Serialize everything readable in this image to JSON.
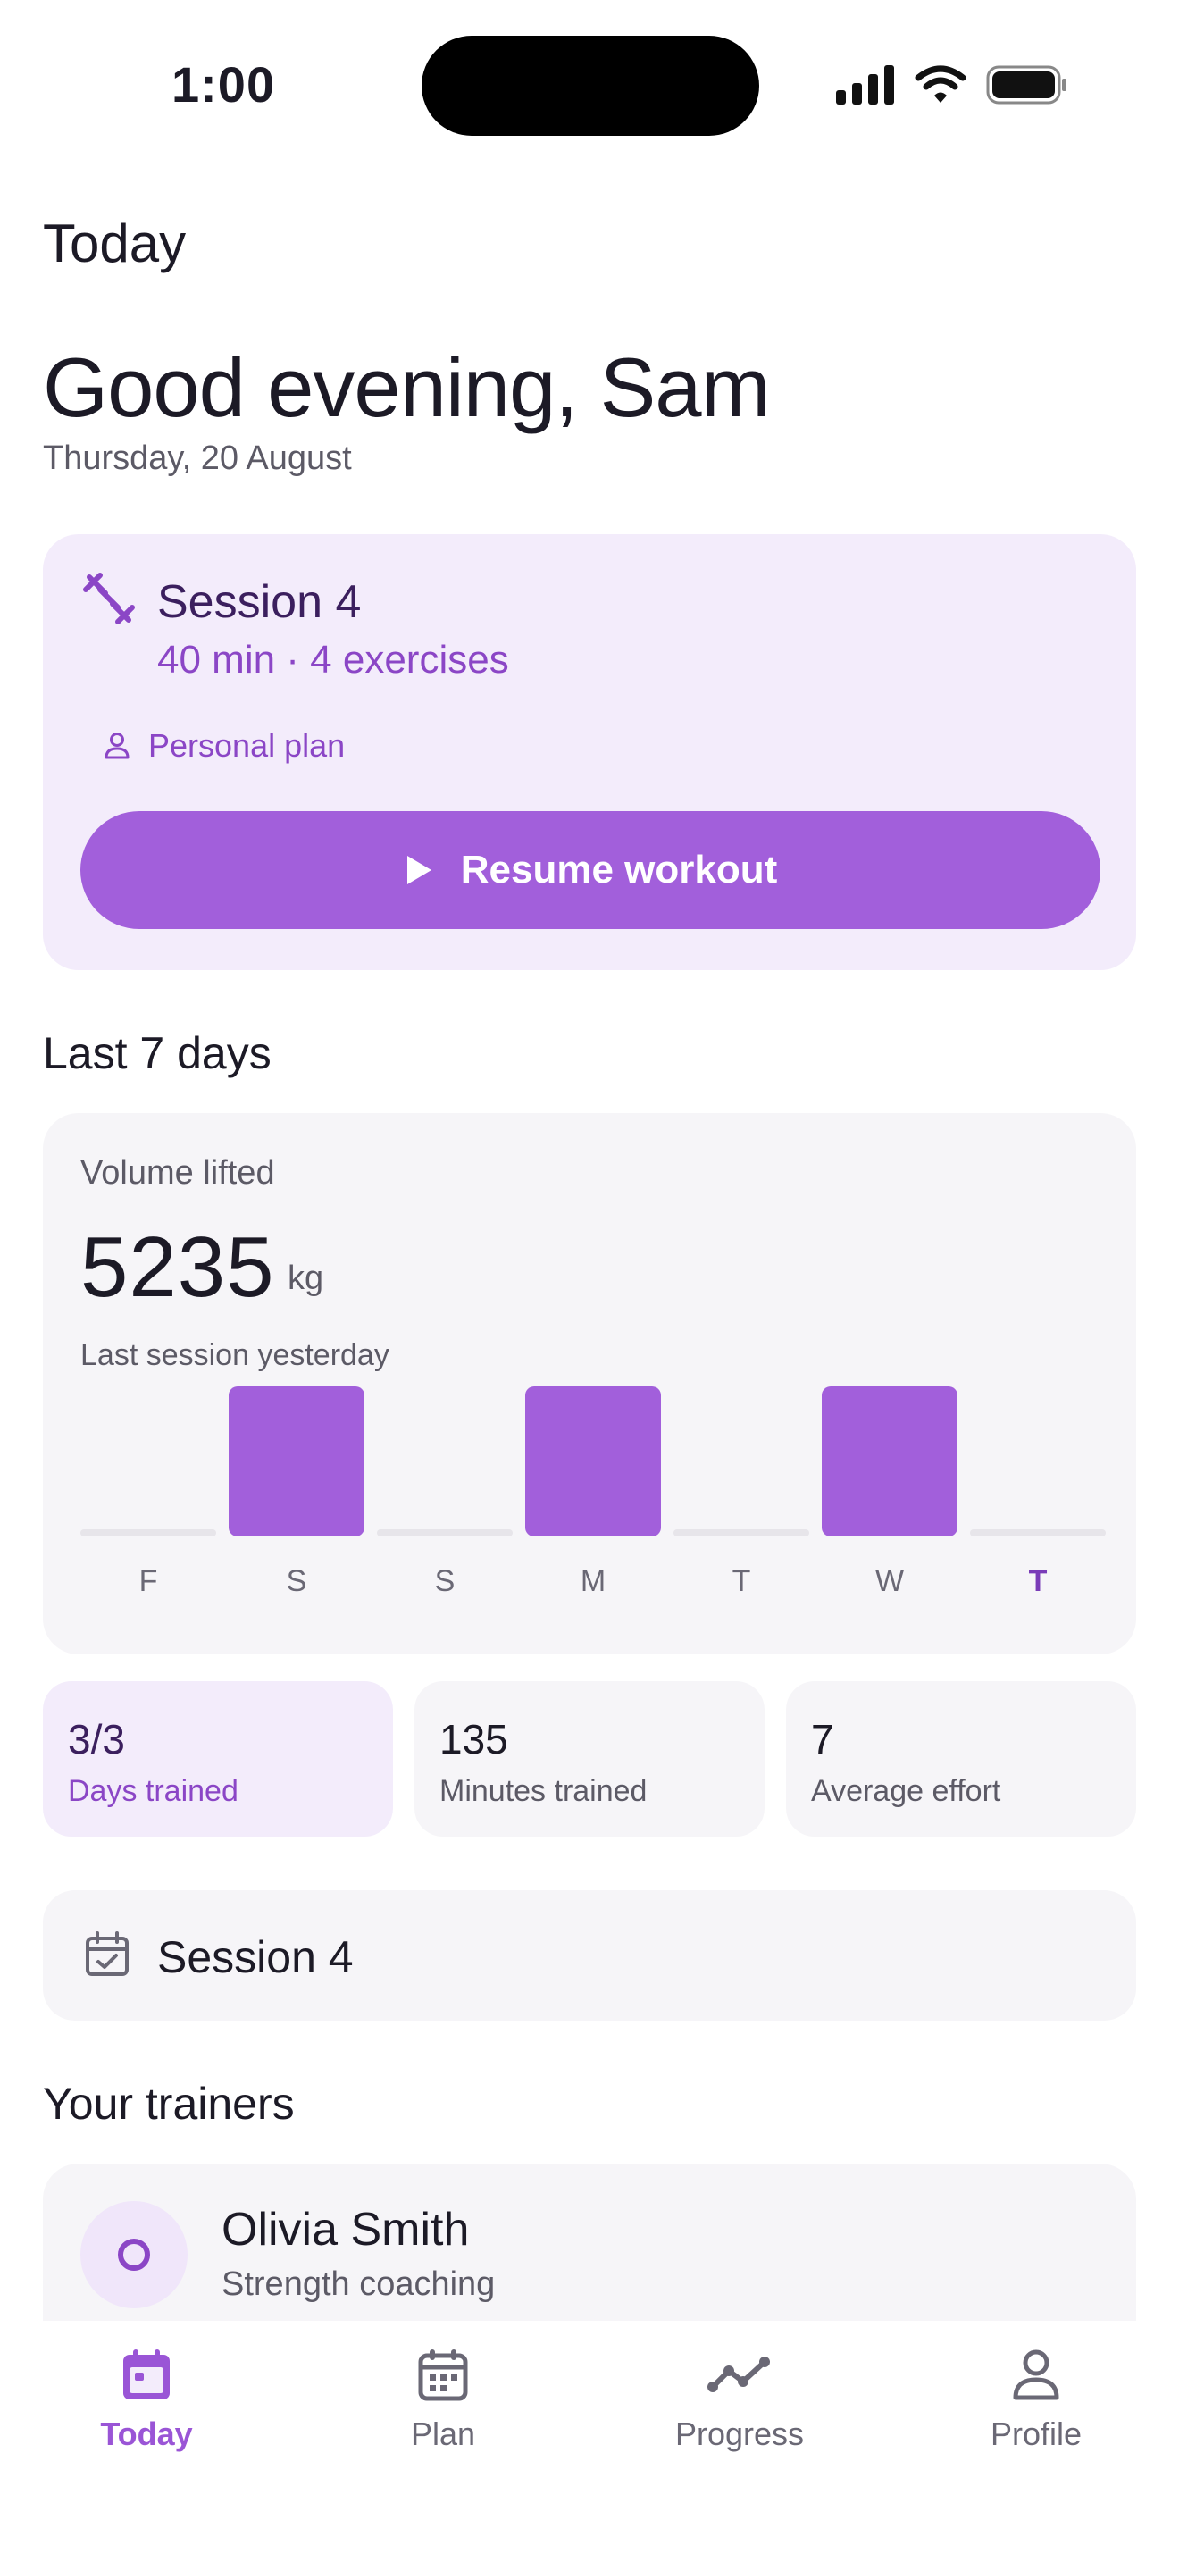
{
  "status_bar": {
    "time": "1:00",
    "icons": [
      "cellular-signal-icon",
      "wifi-icon",
      "battery-icon"
    ]
  },
  "header": {
    "title": "Today",
    "greeting": "Good evening, Sam",
    "date": "Thursday, 20 August"
  },
  "session_card": {
    "icon": "dumbbell-icon",
    "title": "Session 4",
    "meta": "40 min · 4 exercises",
    "plan_icon": "person-icon",
    "plan_label": "Personal plan",
    "button_icon": "play-icon",
    "button_label": "Resume workout"
  },
  "last7": {
    "section_title": "Last 7 days",
    "volume_label": "Volume lifted",
    "volume_value": "5235",
    "volume_unit": "kg",
    "last_session": "Last session yesterday"
  },
  "chart_data": {
    "type": "bar",
    "categories": [
      "F",
      "S",
      "S",
      "M",
      "T",
      "W",
      "T"
    ],
    "values": [
      0,
      1,
      0,
      1,
      0,
      1,
      0
    ],
    "highlight_index": 6
  },
  "stats": [
    {
      "value": "3/3",
      "label": "Days trained"
    },
    {
      "value": "135",
      "label": "Minutes trained"
    },
    {
      "value": "7",
      "label": "Average effort"
    }
  ],
  "upcoming": {
    "icon": "calendar-check-icon",
    "title": "Session 4"
  },
  "trainers": {
    "section_title": "Your trainers",
    "items": [
      {
        "name": "Olivia Smith",
        "role": "Strength coaching"
      }
    ]
  },
  "tab_bar": {
    "tabs": [
      {
        "label": "Today",
        "icon": "calendar-today-icon",
        "active": true
      },
      {
        "label": "Plan",
        "icon": "calendar-grid-icon",
        "active": false
      },
      {
        "label": "Progress",
        "icon": "trend-line-icon",
        "active": false
      },
      {
        "label": "Profile",
        "icon": "person-icon",
        "active": false
      }
    ]
  },
  "colors": {
    "accent": "#a25fdb",
    "accent_light": "#f3ecfb",
    "card": "#f6f5f8"
  }
}
